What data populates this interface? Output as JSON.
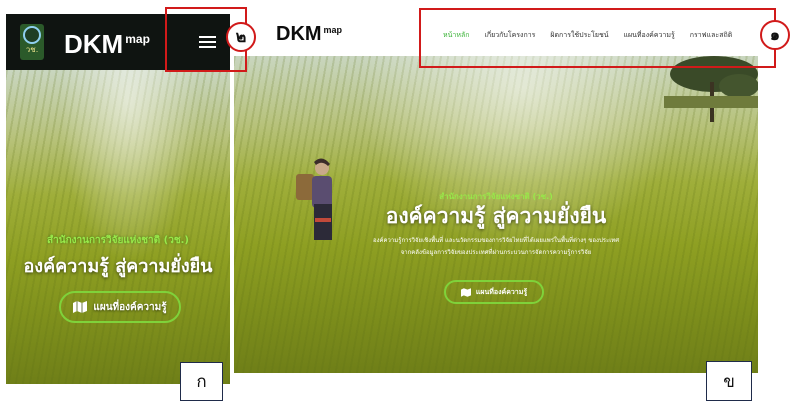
{
  "mobile": {
    "logo_text": "วช.",
    "brand": "DKM",
    "brand_sup": "map",
    "hero": {
      "subtitle": "สำนักงานการวิจัยแห่งชาติ (วช.)",
      "title": "องค์ความรู้ สู่ความยั่งยืน",
      "cta_label": "แผนที่องค์ความรู้"
    }
  },
  "desktop": {
    "brand": "DKM",
    "brand_sup": "map",
    "nav": [
      {
        "label": "หน้าหลัก",
        "active": true
      },
      {
        "label": "เกี่ยวกับโครงการ",
        "active": false
      },
      {
        "label": "ผิดการใช้ประโยชน์",
        "active": false
      },
      {
        "label": "แผนที่องค์ความรู้",
        "active": false
      },
      {
        "label": "กราฟและสถิติ",
        "active": false
      }
    ],
    "hero": {
      "subtitle": "สำนักงานการวิจัยแห่งชาติ (วช.)",
      "title": "องค์ความรู้ สู่ความยั่งยืน",
      "desc_line1": "องค์ความรู้การวิจัยเชิงพื้นที่ และนวัตกรรมของการวิจัยไทยที่ได้เผยแพร่ในพื้นที่ต่างๆ ของประเทศ",
      "desc_line2": "จากคลังข้อมูลการวิจัยของประเทศที่ผ่านกระบวนการจัดการความรู้การวิจัย",
      "cta_label": "แผนที่องค์ความรู้"
    }
  },
  "annotations": {
    "circle_1": "๑",
    "circle_2": "๒",
    "label_a": "ก",
    "label_b": "ข"
  },
  "colors": {
    "accent_green": "#3db43a",
    "annotation_red": "#d11a1a",
    "mobile_header_bg": "#0f1411"
  }
}
